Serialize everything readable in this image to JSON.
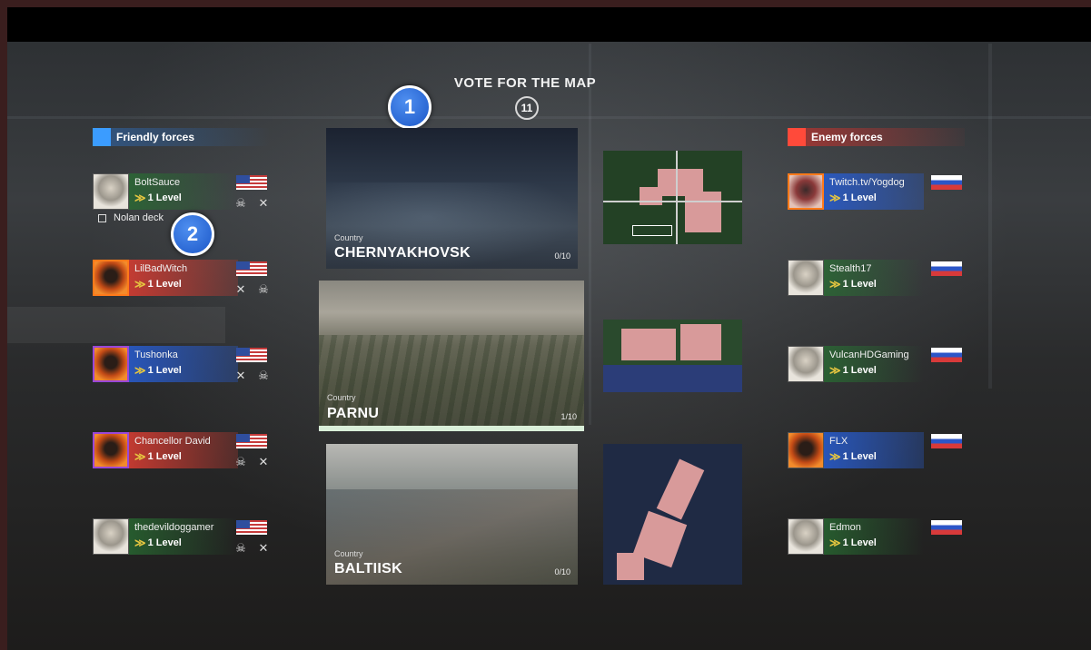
{
  "header": {
    "title": "VOTE FOR THE MAP",
    "timer": "11"
  },
  "markers": [
    "1",
    "2"
  ],
  "friendly": {
    "label": "Friendly forces",
    "deck": "Nolan deck",
    "players": [
      {
        "name": "BoltSauce",
        "level": "1 Level"
      },
      {
        "name": "LilBadWitch",
        "level": "1 Level"
      },
      {
        "name": "Tushonka",
        "level": "1 Level"
      },
      {
        "name": "Chancellor David",
        "level": "1 Level"
      },
      {
        "name": "thedevildoggamer",
        "level": "1 Level"
      }
    ]
  },
  "enemy": {
    "label": "Enemy forces",
    "players": [
      {
        "name": "Twitch.tv/Yogdog",
        "level": "1 Level"
      },
      {
        "name": "Stealth17",
        "level": "1 Level"
      },
      {
        "name": "VulcanHDGaming",
        "level": "1 Level"
      },
      {
        "name": "FLX",
        "level": "1 Level"
      },
      {
        "name": "Edmon",
        "level": "1 Level"
      }
    ]
  },
  "maps": [
    {
      "country": "Country",
      "name": "CHERNYAKHOVSK",
      "votes": "0/10"
    },
    {
      "country": "Country",
      "name": "PARNU",
      "votes": "1/10"
    },
    {
      "country": "Country",
      "name": "BALTIISK",
      "votes": "0/10"
    }
  ],
  "colors": {
    "friendly_accent": "#3b9cff",
    "enemy_accent": "#ff4a3a",
    "level_chevron": "#e6c640",
    "marker_blue": "#1b57c8"
  }
}
